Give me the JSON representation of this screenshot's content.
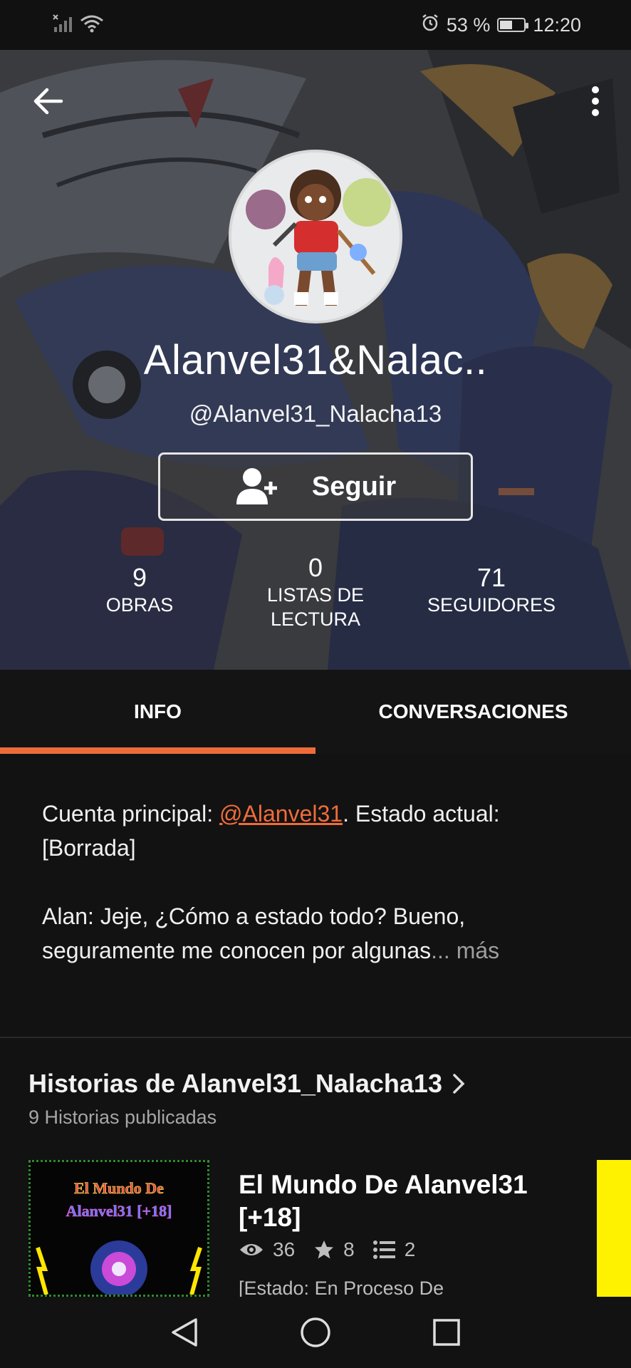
{
  "status_bar": {
    "battery_percent": "53 %",
    "battery_level": 0.53,
    "time": "12:20",
    "icons": [
      "signal-icon",
      "wifi-icon",
      "alarm-icon",
      "battery-icon"
    ]
  },
  "profile": {
    "display_name": "Alanvel31&Nalac..",
    "handle": "@Alanvel31_Nalacha13",
    "follow_label": "Seguir"
  },
  "stats": {
    "works": {
      "value": "9",
      "label": "OBRAS"
    },
    "reading_lists": {
      "value": "0",
      "label_line1": "LISTAS DE",
      "label_line2": "LECTURA"
    },
    "followers": {
      "value": "71",
      "label": "SEGUIDORES"
    }
  },
  "tabs": [
    {
      "label": "INFO",
      "active": true
    },
    {
      "label": "CONVERSACIONES",
      "active": false
    }
  ],
  "about": {
    "line1_prefix": "Cuenta principal: ",
    "mention": "@Alanvel31",
    "line1_suffix": ". Estado actual: [Borrada]",
    "line2": "Alan: Jeje, ¿Cómo a estado todo? Bueno, seguramente me conocen por algunas",
    "ellipsis": "...",
    "more": " más"
  },
  "stories": {
    "title": "Historias de Alanvel31_Nalacha13",
    "count_text": "9 Historias publicadas",
    "items": [
      {
        "title": "El Mundo De Alanvel31 [+18]",
        "cover_line1": "El Mundo De",
        "cover_line2": "Alanvel31 [+18]",
        "reads": "36",
        "votes": "8",
        "parts": "2",
        "description": "[Estado: En Proceso De"
      }
    ]
  },
  "colors": {
    "accent": "#ef6c3a",
    "background": "#121212",
    "tab_bar": "#141414"
  }
}
